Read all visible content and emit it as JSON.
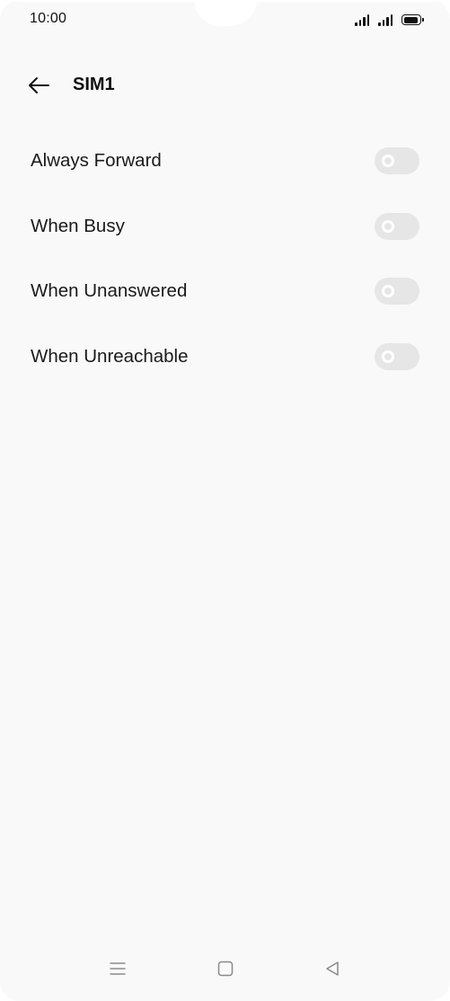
{
  "status_bar": {
    "time": "10:00",
    "battery_level": 1.0
  },
  "header": {
    "back_icon": "arrow-left-icon",
    "title": "SIM1"
  },
  "settings": [
    {
      "label": "Always Forward",
      "enabled": false
    },
    {
      "label": "When Busy",
      "enabled": false
    },
    {
      "label": "When Unanswered",
      "enabled": false
    },
    {
      "label": "When Unreachable",
      "enabled": false
    }
  ],
  "nav_bar": {
    "menu_icon": "menu-icon",
    "home_icon": "home-square-icon",
    "back_icon": "back-triangle-icon"
  },
  "colors": {
    "background": "#f9f9f9",
    "toggle_off": "#e6e6e6",
    "text": "#1a1a1a"
  }
}
